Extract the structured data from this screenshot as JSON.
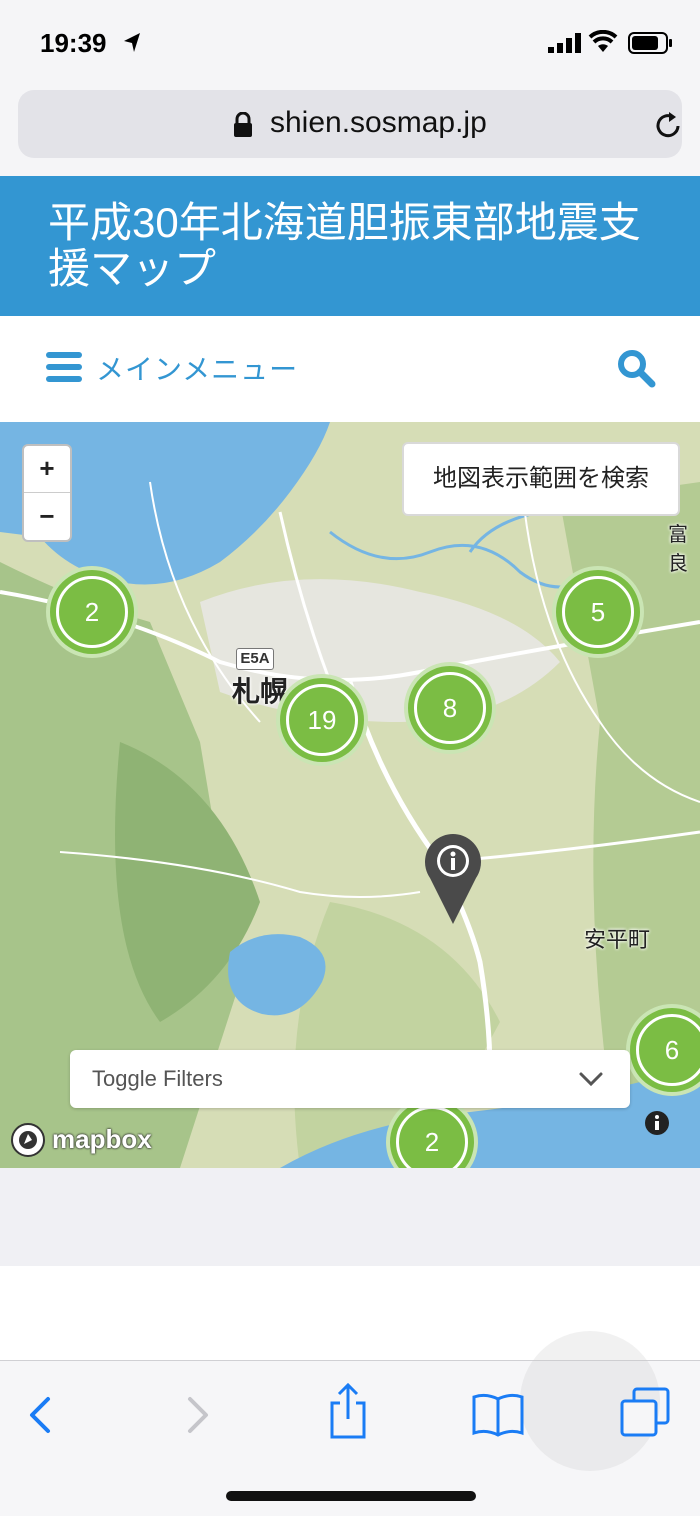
{
  "status_bar": {
    "time": "19:39"
  },
  "browser": {
    "url": "shien.sosmap.jp"
  },
  "site": {
    "title": "平成30年北海道胆振東部地震支援マップ",
    "menu_label": "メインメニュー"
  },
  "map": {
    "zoom_in_label": "+",
    "zoom_out_label": "−",
    "search_area_label": "地図表示範囲を検索",
    "clusters": [
      {
        "count": "2"
      },
      {
        "count": "19"
      },
      {
        "count": "8"
      },
      {
        "count": "5"
      },
      {
        "count": "6"
      },
      {
        "count": "2"
      }
    ],
    "place_labels": {
      "sapporo": "札幌",
      "abira": "安平町",
      "tomi": "富良",
      "road": "E5A"
    },
    "toggle_filters_label": "Toggle Filters",
    "attribution": "mapbox"
  },
  "colors": {
    "header_blue": "#3396d2",
    "cluster_green": "#7bbd44",
    "water": "#75b5e3"
  }
}
